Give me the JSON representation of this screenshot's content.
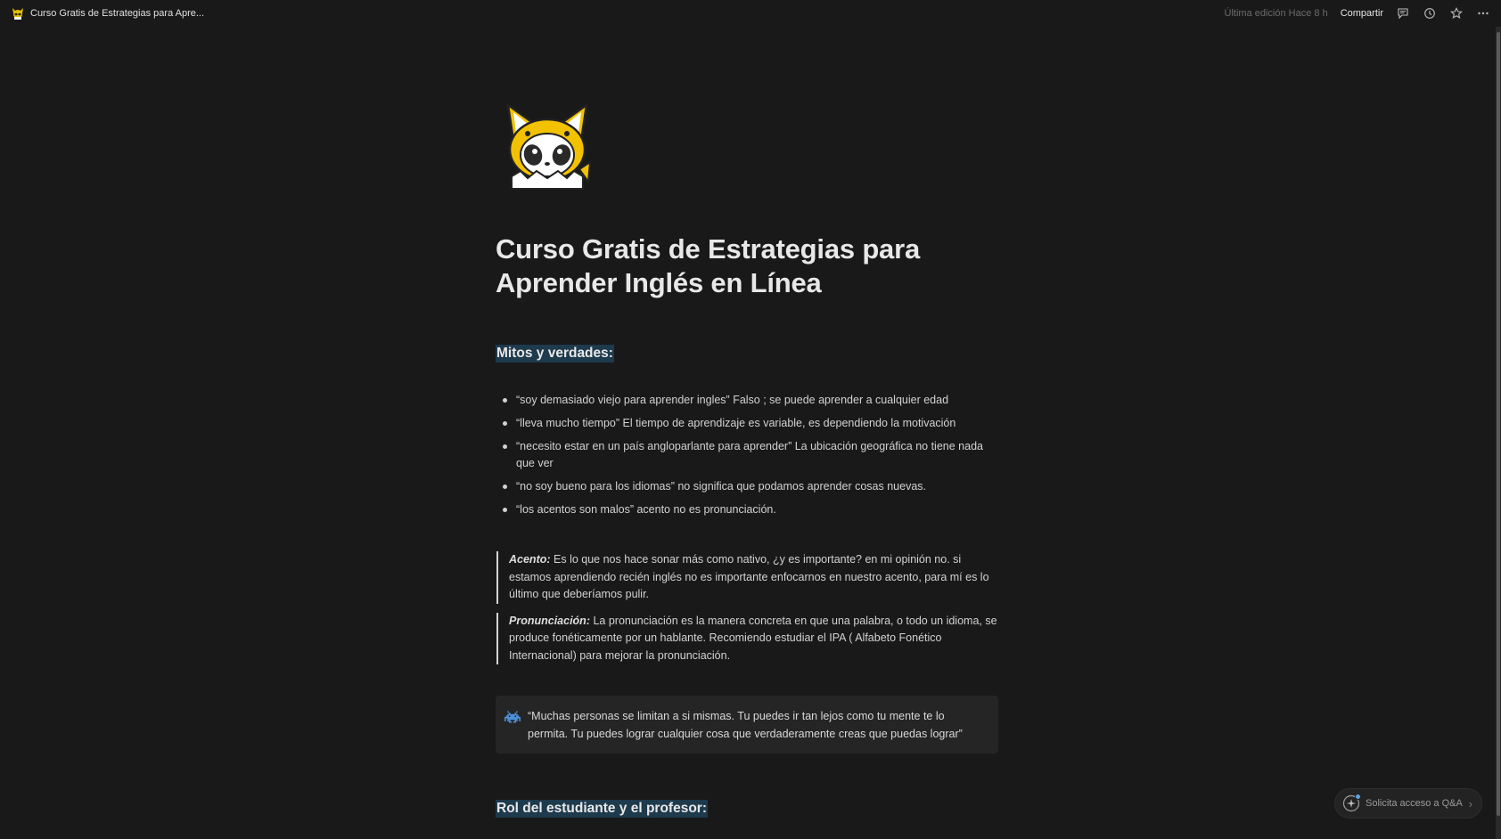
{
  "topbar": {
    "title": "Curso Gratis de Estrategias para Apre...",
    "last_edited": "Última edición Hace 8 h",
    "share_label": "Compartir",
    "icons": [
      "comment-icon",
      "history-icon",
      "star-icon",
      "more-icon"
    ]
  },
  "page": {
    "icon": "fox-panda-mascot",
    "title": "Curso Gratis de Estrategias para Aprender Inglés en Línea",
    "section1": {
      "heading": "Mitos y verdades:",
      "bullets": [
        "“soy demasiado viejo para aprender ingles” Falso ; se puede aprender a cualquier edad",
        "“lleva mucho tiempo” El tiempo de aprendizaje es variable, es dependiendo la motivación",
        "“necesito estar en un país angloparlante para aprender” La ubicación geográfica no tiene nada que ver",
        "“no soy bueno para los idiomas” no significa que podamos aprender cosas nuevas.",
        "“los acentos son malos” acento no es pronunciación."
      ]
    },
    "quotes": [
      {
        "term": "Acento:",
        "text": " Es lo que nos hace sonar más como nativo, ¿y es importante? en mi opinión no. si estamos aprendiendo recién inglés no es importante enfocarnos en nuestro acento, para mí es lo último que deberíamos pulir."
      },
      {
        "term": "Pronunciación:",
        "text": " La pronunciación es la manera concreta en que una palabra, o todo un idioma, se produce fonéticamente por un hablante. Recomiendo estudiar el IPA ( Alfabeto Fonético Internacional) para mejorar la pronunciación."
      }
    ],
    "callout": {
      "icon": "space-invader-icon",
      "text": "“Muchas personas se limitan a si mismas. Tu puedes ir tan lejos como tu mente te lo permita. Tu puedes lograr cualquier cosa que verdaderamente creas que puedas lograr”"
    },
    "section2": {
      "heading": "Rol del estudiante y el profesor:"
    }
  },
  "qa_button": {
    "label": "Solicita acceso a Q&A"
  },
  "colors": {
    "background": "#191919",
    "heading_highlight": "#1e3a4d",
    "callout_bg": "#252525",
    "accent_blue": "#5aa0e6"
  }
}
